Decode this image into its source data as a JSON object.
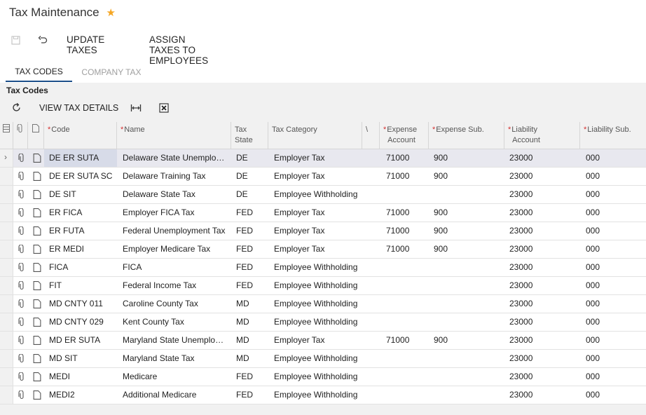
{
  "page": {
    "title": "Tax Maintenance"
  },
  "toolbar": {
    "update_taxes": "UPDATE TAXES",
    "assign_taxes": "ASSIGN TAXES TO EMPLOYEES"
  },
  "tabs": [
    {
      "label": "TAX CODES",
      "active": true
    },
    {
      "label": "COMPANY TAX",
      "active": false
    }
  ],
  "grid": {
    "title": "Tax Codes",
    "view_tax_details": "VIEW TAX DETAILS",
    "columns": {
      "code": "Code",
      "name": "Name",
      "tax_state_1": "Tax",
      "tax_state_2": "State",
      "tax_category": "Tax Category",
      "v": "\\",
      "expense_account_1": "Expense",
      "expense_account_2": "Account",
      "expense_sub": "Expense Sub.",
      "liability_account_1": "Liability",
      "liability_account_2": "Account",
      "liability_sub": "Liability Sub."
    },
    "rows": [
      {
        "code": "DE ER SUTA",
        "name": "Delaware State Unemplo…",
        "state": "DE",
        "category": "Employer Tax",
        "exp_acct": "71000",
        "exp_sub": "900",
        "liab_acct": "23000",
        "liab_sub": "000"
      },
      {
        "code": "DE ER SUTA SC",
        "name": "Delaware Training Tax",
        "state": "DE",
        "category": "Employer Tax",
        "exp_acct": "71000",
        "exp_sub": "900",
        "liab_acct": "23000",
        "liab_sub": "000"
      },
      {
        "code": "DE SIT",
        "name": "Delaware State Tax",
        "state": "DE",
        "category": "Employee Withholding",
        "exp_acct": "",
        "exp_sub": "",
        "liab_acct": "23000",
        "liab_sub": "000"
      },
      {
        "code": "ER FICA",
        "name": "Employer FICA Tax",
        "state": "FED",
        "category": "Employer Tax",
        "exp_acct": "71000",
        "exp_sub": "900",
        "liab_acct": "23000",
        "liab_sub": "000"
      },
      {
        "code": "ER FUTA",
        "name": "Federal Unemployment Tax",
        "state": "FED",
        "category": "Employer Tax",
        "exp_acct": "71000",
        "exp_sub": "900",
        "liab_acct": "23000",
        "liab_sub": "000"
      },
      {
        "code": "ER MEDI",
        "name": "Employer Medicare Tax",
        "state": "FED",
        "category": "Employer Tax",
        "exp_acct": "71000",
        "exp_sub": "900",
        "liab_acct": "23000",
        "liab_sub": "000"
      },
      {
        "code": "FICA",
        "name": "FICA",
        "state": "FED",
        "category": "Employee Withholding",
        "exp_acct": "",
        "exp_sub": "",
        "liab_acct": "23000",
        "liab_sub": "000"
      },
      {
        "code": "FIT",
        "name": "Federal Income Tax",
        "state": "FED",
        "category": "Employee Withholding",
        "exp_acct": "",
        "exp_sub": "",
        "liab_acct": "23000",
        "liab_sub": "000"
      },
      {
        "code": "MD CNTY 011",
        "name": "Caroline County Tax",
        "state": "MD",
        "category": "Employee Withholding",
        "exp_acct": "",
        "exp_sub": "",
        "liab_acct": "23000",
        "liab_sub": "000"
      },
      {
        "code": "MD CNTY 029",
        "name": "Kent County Tax",
        "state": "MD",
        "category": "Employee Withholding",
        "exp_acct": "",
        "exp_sub": "",
        "liab_acct": "23000",
        "liab_sub": "000"
      },
      {
        "code": "MD ER SUTA",
        "name": "Maryland State Unemploy…",
        "state": "MD",
        "category": "Employer Tax",
        "exp_acct": "71000",
        "exp_sub": "900",
        "liab_acct": "23000",
        "liab_sub": "000"
      },
      {
        "code": "MD SIT",
        "name": "Maryland State Tax",
        "state": "MD",
        "category": "Employee Withholding",
        "exp_acct": "",
        "exp_sub": "",
        "liab_acct": "23000",
        "liab_sub": "000"
      },
      {
        "code": "MEDI",
        "name": "Medicare",
        "state": "FED",
        "category": "Employee Withholding",
        "exp_acct": "",
        "exp_sub": "",
        "liab_acct": "23000",
        "liab_sub": "000"
      },
      {
        "code": "MEDI2",
        "name": "Additional Medicare",
        "state": "FED",
        "category": "Employee Withholding",
        "exp_acct": "",
        "exp_sub": "",
        "liab_acct": "23000",
        "liab_sub": "000"
      }
    ]
  },
  "colors": {
    "accent": "#1c4f8a",
    "star": "#f5a623",
    "required": "#d32f2f",
    "selected_row": "#e8e8ef"
  }
}
